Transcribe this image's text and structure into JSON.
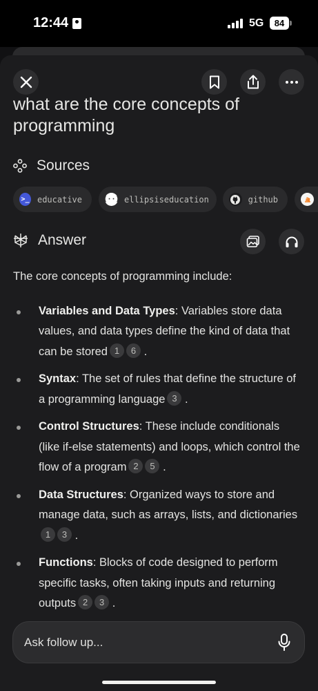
{
  "status_bar": {
    "time": "12:44",
    "network": "5G",
    "battery": "84"
  },
  "header": {
    "close_icon": "close-icon",
    "bookmark_icon": "bookmark-icon",
    "share_icon": "share-icon",
    "more_icon": "more-icon"
  },
  "question": "what are the core concepts of programming",
  "sources": {
    "title": "Sources",
    "items": [
      {
        "label": "educative",
        "icon": "educative-favicon",
        "color": "#4458d9"
      },
      {
        "label": "ellipsiseducation",
        "icon": "ellipsis-favicon",
        "color": "#ffffff"
      },
      {
        "label": "github",
        "icon": "github-favicon",
        "color": "#e6e6e4"
      },
      {
        "label": "",
        "icon": "stackoverflow-favicon",
        "color": "#f48024"
      }
    ]
  },
  "answer": {
    "title": "Answer",
    "intro": "The core concepts of programming include:",
    "bullets": [
      {
        "term": "Variables and Data Types",
        "text": ": Variables store data values, and data types define the kind of data that can be stored",
        "citations": [
          "1",
          "6"
        ]
      },
      {
        "term": "Syntax",
        "text": ": The set of rules that define the structure of a programming language",
        "citations": [
          "3"
        ]
      },
      {
        "term": "Control Structures",
        "text": ": These include conditionals (like if-else statements) and loops, which control the flow of a program",
        "citations": [
          "2",
          "5"
        ]
      },
      {
        "term": "Data Structures",
        "text": ": Organized ways to store and manage data, such as arrays, lists, and dictionaries",
        "citations": [
          "1",
          "3"
        ]
      },
      {
        "term": "Functions",
        "text": ": Blocks of code designed to perform specific tasks, often taking inputs and returning outputs",
        "citations": [
          "2",
          "3"
        ]
      }
    ]
  },
  "followup": {
    "placeholder": "Ask follow up..."
  },
  "colors": {
    "background": "#1c1c1e",
    "chip": "#2a2a2c",
    "text": "#e6e6e4"
  }
}
